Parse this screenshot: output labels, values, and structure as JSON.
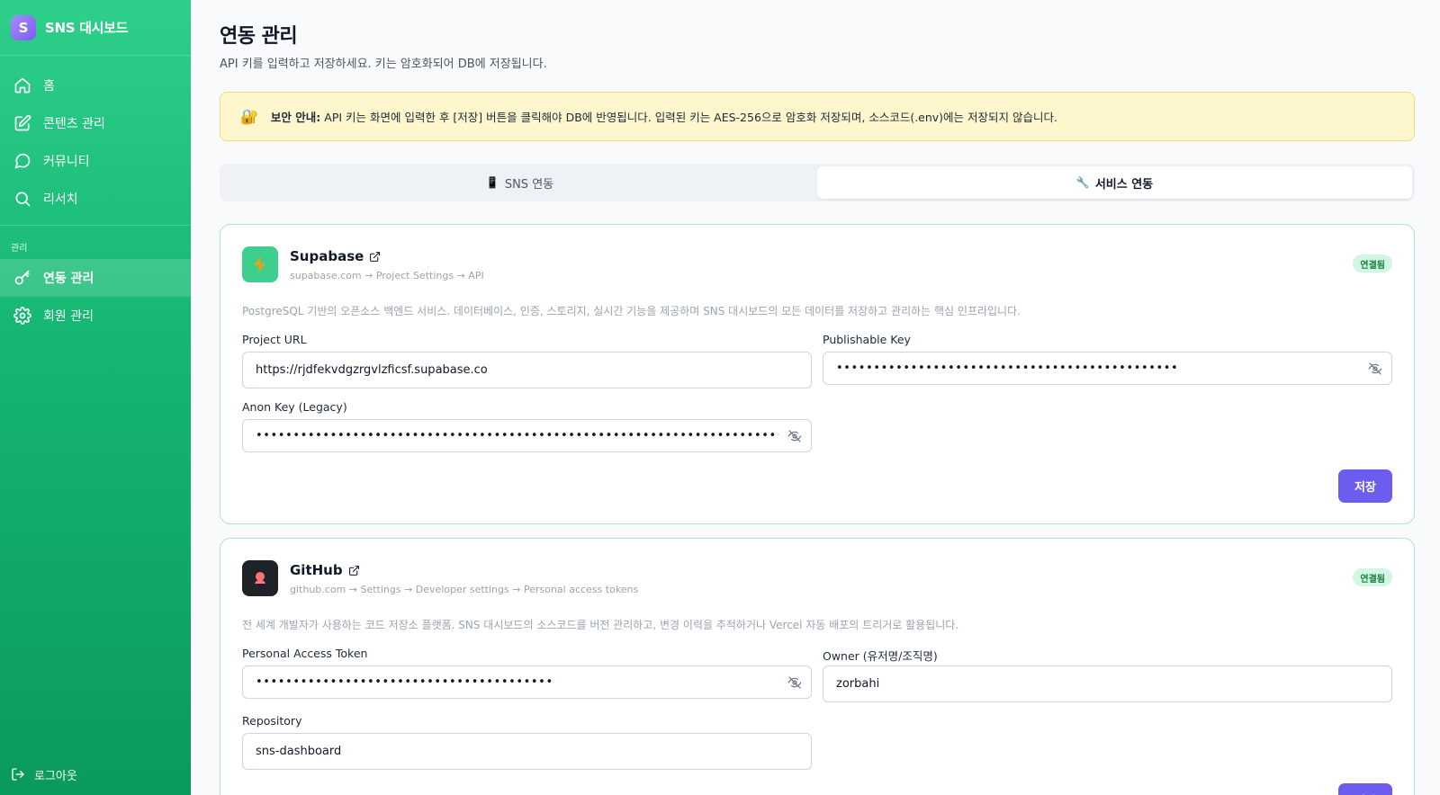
{
  "sidebar": {
    "brand_letter": "S",
    "brand_title": "SNS 대시보드",
    "items": [
      {
        "label": "홈",
        "icon": "home-icon"
      },
      {
        "label": "콘텐츠 관리",
        "icon": "edit-icon"
      },
      {
        "label": "커뮤니티",
        "icon": "chat-icon"
      },
      {
        "label": "리서치",
        "icon": "search-icon"
      }
    ],
    "section_label": "관리",
    "admin_items": [
      {
        "label": "연동 관리",
        "icon": "key-icon",
        "active": true
      },
      {
        "label": "회원 관리",
        "icon": "gear-icon"
      }
    ],
    "logout_label": "로그아웃"
  },
  "header": {
    "title": "연동 관리",
    "subtitle": "API 키를 입력하고 저장하세요. 키는 암호화되어 DB에 저장됩니다."
  },
  "notice": {
    "icon": "🔐",
    "label": "보안 안내:",
    "text": "API 키는 화면에 입력한 후 [저장] 버튼을 클릭해야 DB에 반영됩니다. 입력된 키는 AES-256으로 암호화 저장되며, 소스코드(.env)에는 저장되지 않습니다."
  },
  "tabs": [
    {
      "icon": "📱",
      "label": "SNS 연동"
    },
    {
      "icon": "🔧",
      "label": "서비스 연동",
      "active": true
    }
  ],
  "services": {
    "supabase": {
      "name": "Supabase",
      "path": "supabase.com → Project Settings → API",
      "status": "연결됨",
      "description": "PostgreSQL 기반의 오픈소스 백엔드 서비스. 데이터베이스, 인증, 스토리지, 실시간 기능을 제공하며 SNS 대시보드의 모든 데이터를 저장하고 관리하는 핵심 인프라입니다.",
      "fields": {
        "project_url": {
          "label": "Project URL",
          "value": "https://rjdfekvdgzrgvlzficsf.supabase.co"
        },
        "publishable_key": {
          "label": "Publishable Key",
          "value": "••••••••••••••••••••••••••••••••••••••••••••••"
        },
        "anon_key": {
          "label": "Anon Key (Legacy)",
          "value": "••••••••••••••••••••••••••••••••••••••••••••••••••••••••••••••••••••••••••••••••••••••"
        }
      },
      "save_label": "저장"
    },
    "github": {
      "name": "GitHub",
      "path": "github.com → Settings → Developer settings → Personal access tokens",
      "status": "연결됨",
      "description": "전 세계 개발자가 사용하는 코드 저장소 플랫폼. SNS 대시보드의 소스코드를 버전 관리하고, 변경 이력을 추적하거나 Vercel 자동 배포의 트리거로 활용됩니다.",
      "fields": {
        "token": {
          "label": "Personal Access Token",
          "value": "••••••••••••••••••••••••••••••••••••••••"
        },
        "owner": {
          "label": "Owner (유저명/조직명)",
          "value": "zorbahi"
        },
        "repository": {
          "label": "Repository",
          "value": "sns-dashboard"
        }
      },
      "save_label": "저장"
    }
  }
}
